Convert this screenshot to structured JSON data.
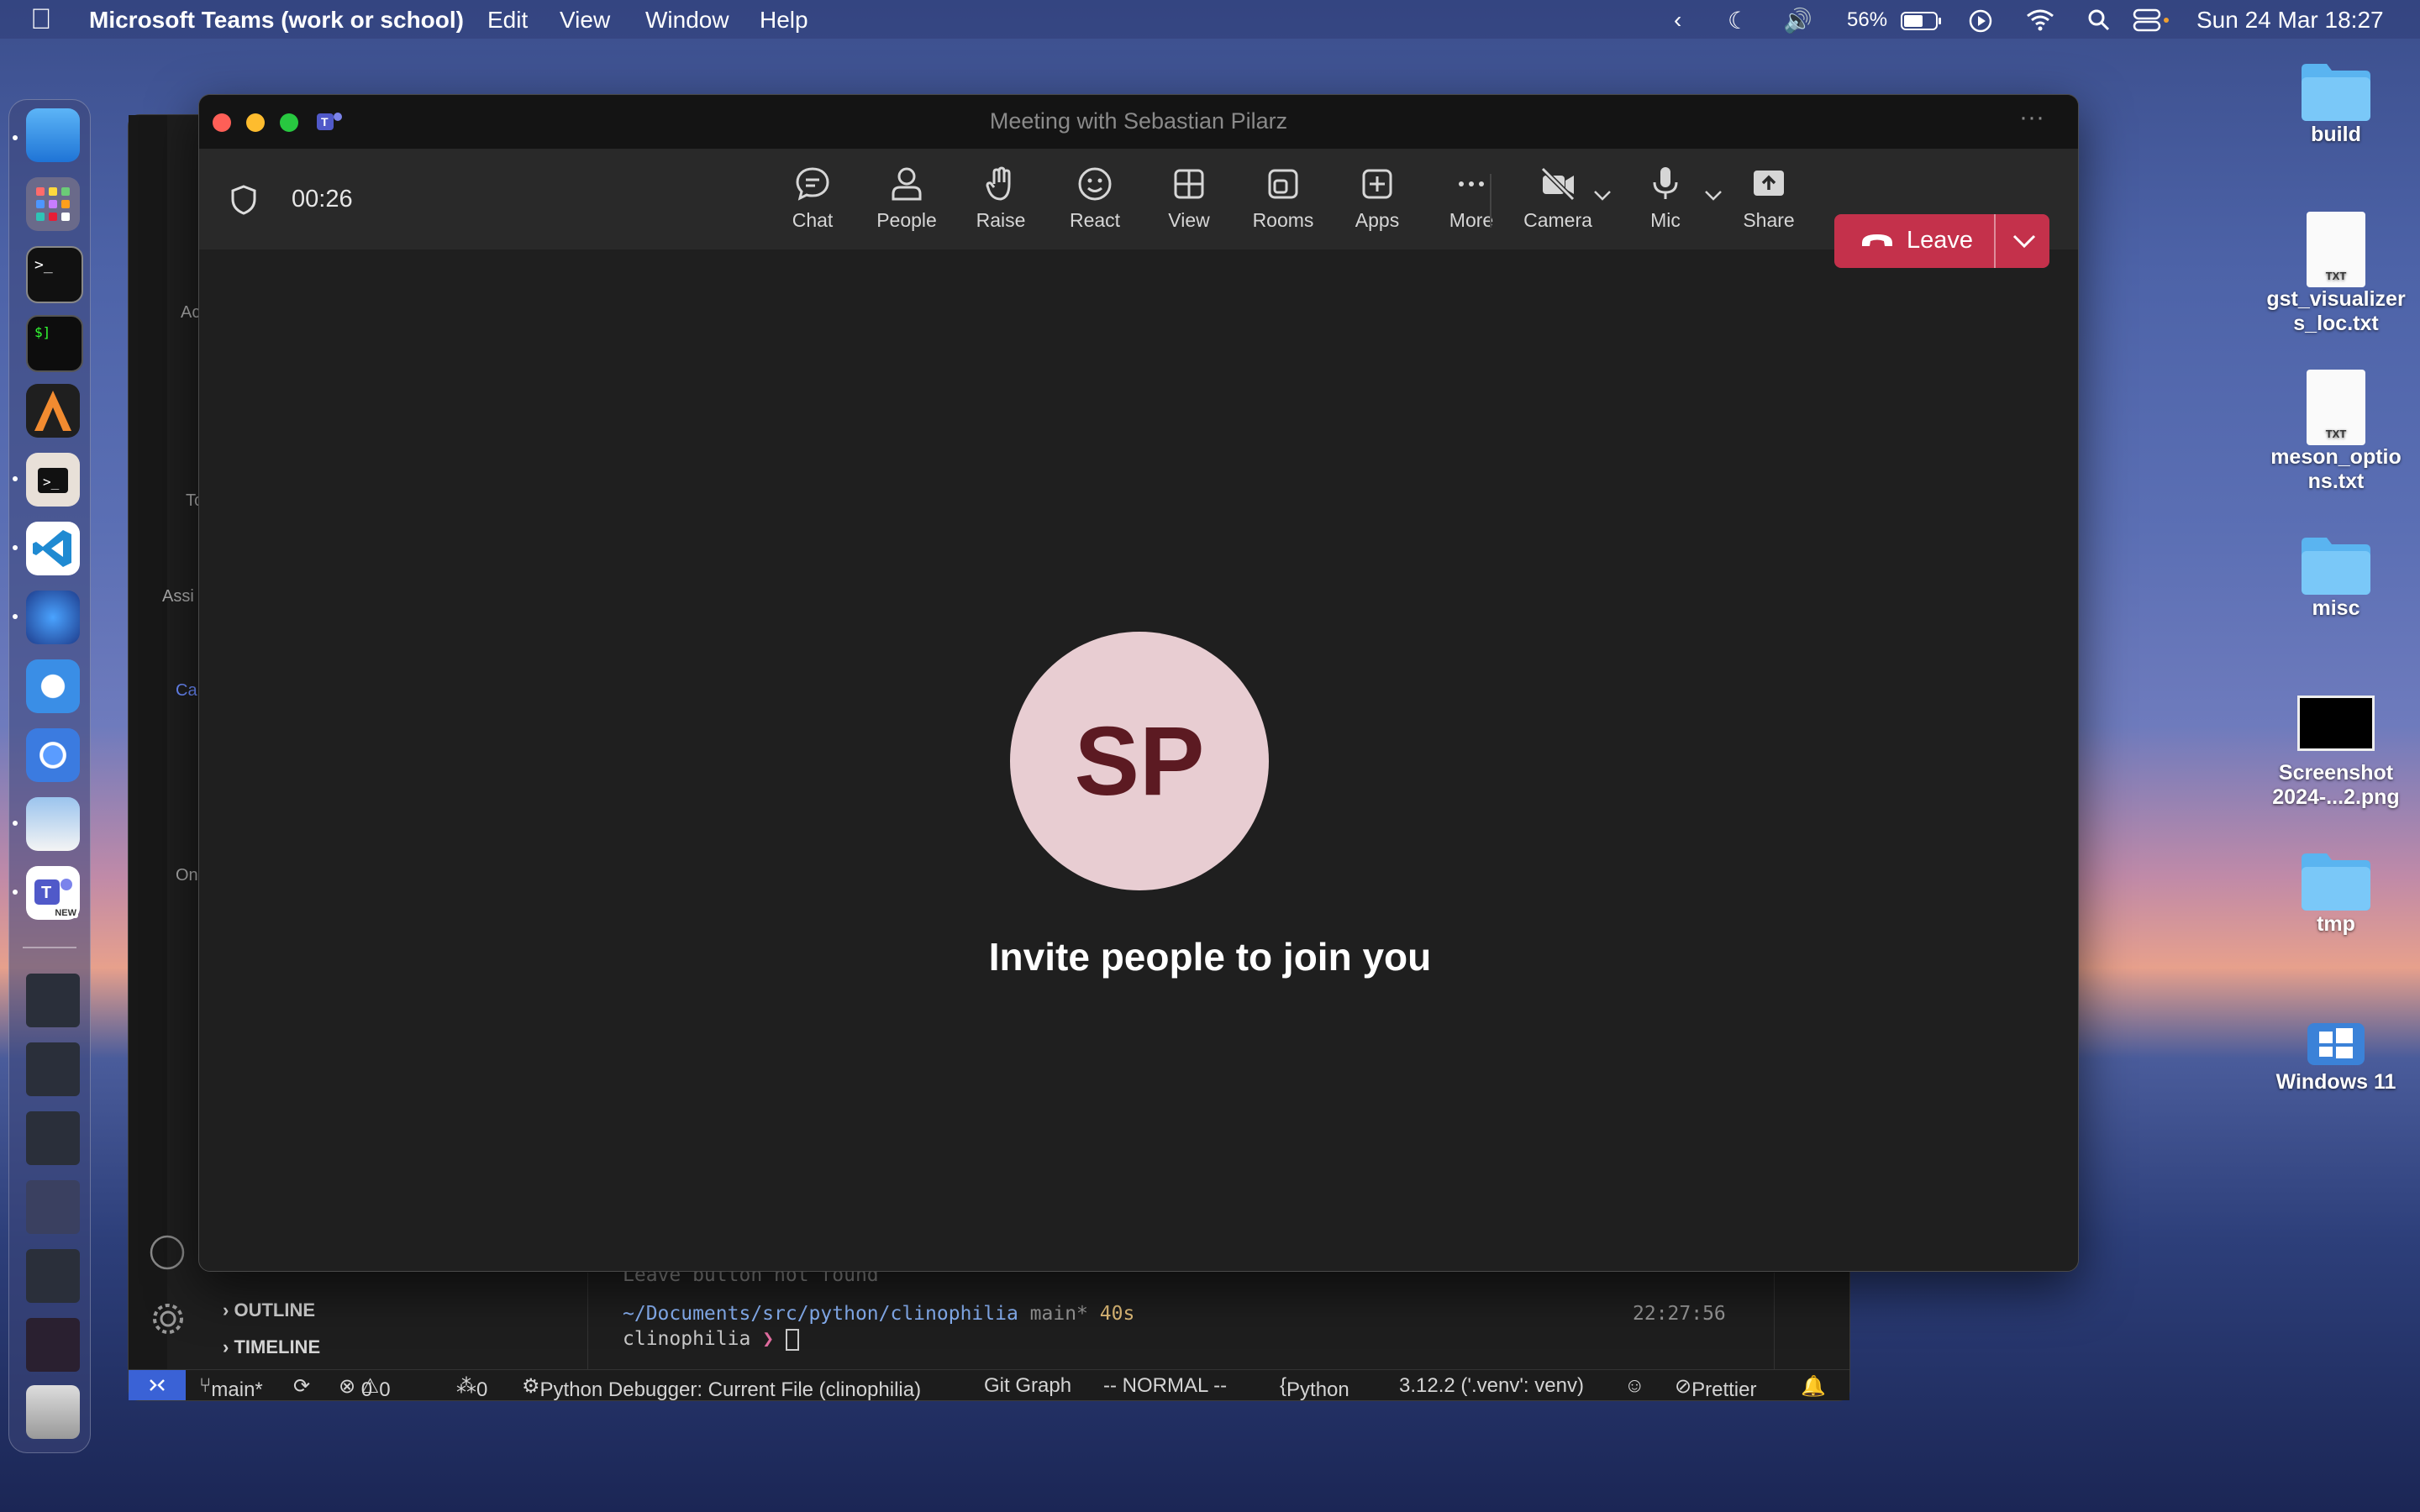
{
  "menubar": {
    "app_name": "Microsoft Teams (work or school)",
    "menus": [
      "Edit",
      "View",
      "Window",
      "Help"
    ],
    "battery": "56%",
    "datetime": "Sun 24 Mar  18:27"
  },
  "vscode": {
    "panels": [
      "OUTLINE",
      "TIMELINE"
    ],
    "terminal": {
      "prev_line": "Leave button not found",
      "path": "~/Documents/src/python/clinophilia",
      "branch": "main*",
      "duration": "40s",
      "time": "22:27:56",
      "prompt_dir": "clinophilia",
      "prompt_char": "❯"
    },
    "status": {
      "branch": "main*",
      "errors": "0",
      "warnings": "0",
      "ports": "0",
      "debug": "Python Debugger: Current File (clinophilia)",
      "git_graph": "Git Graph",
      "mode": "-- NORMAL --",
      "language": "Python",
      "interpreter": "3.12.2 ('.venv': venv)",
      "formatter": "Prettier"
    },
    "bg_fragments": [
      "Ac",
      "Tc",
      "Assi",
      "Ca",
      "On"
    ]
  },
  "teams": {
    "window_title": "Meeting with Sebastian Pilarz",
    "timer": "00:26",
    "toolbar": {
      "chat": "Chat",
      "people": "People",
      "raise": "Raise",
      "react": "React",
      "view": "View",
      "rooms": "Rooms",
      "apps": "Apps",
      "more": "More",
      "camera": "Camera",
      "mic": "Mic",
      "share": "Share",
      "leave": "Leave"
    },
    "avatar_initials": "SP",
    "invite_text": "Invite people to join you"
  },
  "desktop": {
    "items": [
      {
        "label": "build",
        "icon": "folder-icon"
      },
      {
        "label": "gst_visualizer",
        "label2": "s_loc.txt",
        "icon": "txt-file-icon"
      },
      {
        "label": "meson_optio",
        "label2": "ns.txt",
        "icon": "txt-file-icon"
      },
      {
        "label": "misc",
        "icon": "folder-icon"
      },
      {
        "label": "Screenshot",
        "label2": "2024-...2.png",
        "icon": "image-file-icon"
      },
      {
        "label": "tmp",
        "icon": "folder-icon"
      },
      {
        "label": "Windows 11",
        "icon": "vm-icon"
      }
    ],
    "txt_badge": "TXT"
  },
  "dock": {
    "new_badge": "NEW"
  },
  "colors": {
    "leave_red": "#c4314b",
    "avatar_bg": "#e8cdd2",
    "avatar_fg": "#5c1a22"
  }
}
